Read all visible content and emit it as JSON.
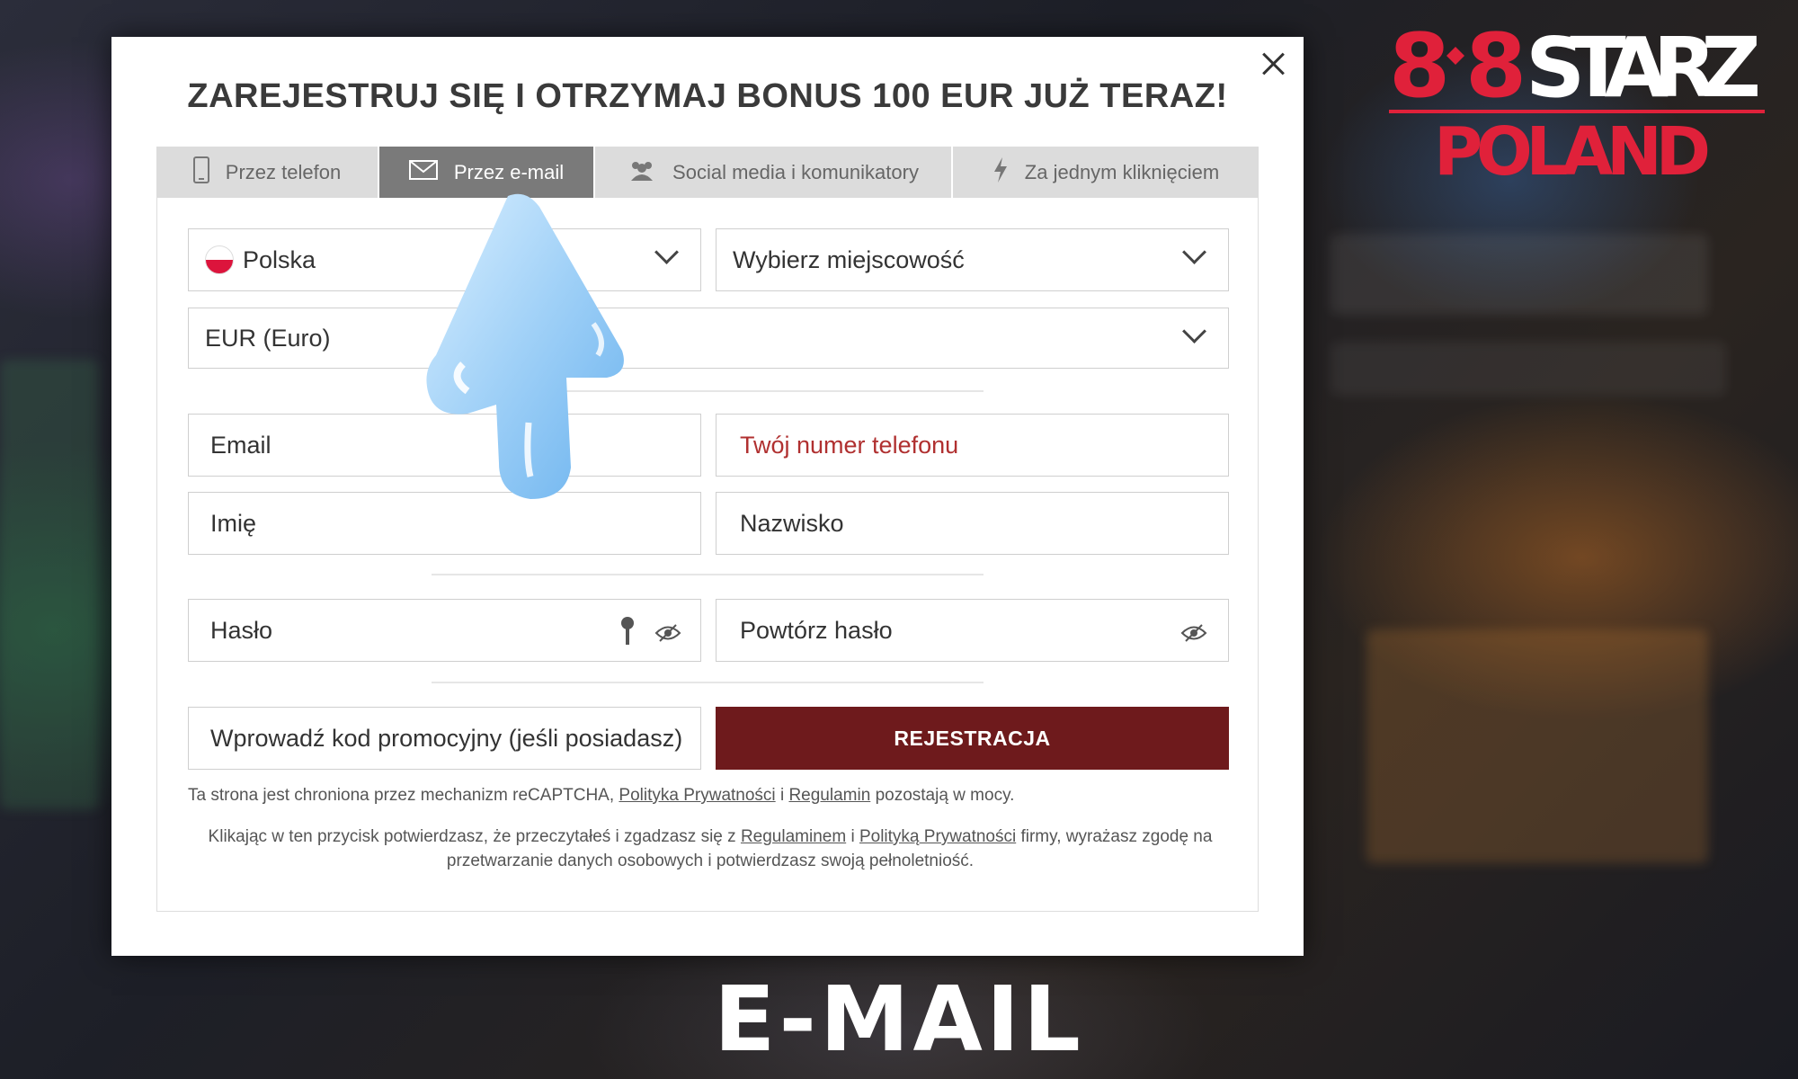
{
  "logo": {
    "brand_left": "8",
    "brand_right": "8",
    "brand_name": "STARZ",
    "region": "POLAND",
    "accent": "#e0213a"
  },
  "modal": {
    "title": "ZAREJESTRUJ SIĘ I OTRZYMAJ BONUS 100 EUR JUŻ TERAZ!",
    "tabs": [
      {
        "label": "Przez telefon",
        "icon": "phone-icon"
      },
      {
        "label": "Przez e-mail",
        "icon": "envelope-icon",
        "active": true
      },
      {
        "label": "Social media i komunikatory",
        "icon": "people-icon"
      },
      {
        "label": "Za jednym kliknięciem",
        "icon": "lightning-icon"
      }
    ],
    "country": "Polska",
    "city_placeholder": "Wybierz miejscowość",
    "currency": "EUR (Euro)",
    "email_placeholder": "Email",
    "phone_placeholder": "Twój numer telefonu",
    "first_name_placeholder": "Imię",
    "last_name_placeholder": "Nazwisko",
    "password_placeholder": "Hasło",
    "repeat_password_placeholder": "Powtórz hasło",
    "promo_placeholder": "Wprowadź kod promocyjny (jeśli posiadasz)",
    "register_label": "REJESTRACJA",
    "recaptcha": {
      "prefix": "Ta strona jest chroniona przez mechanizm reCAPTCHA,",
      "privacy": "Polityka Prywatności",
      "and": "i",
      "terms": "Regulamin",
      "suffix": "pozostają w mocy."
    },
    "consent": {
      "prefix": "Klikając w ten przycisk potwierdzasz, że przeczytałeś i zgadzasz się z",
      "terms": "Regulaminem",
      "and": "i",
      "privacy": "Polityką Prywatności",
      "suffix": "firmy, wyrażasz zgodę na",
      "line2": "przetwarzanie danych osobowych i potwierdzasz swoją pełnoletniość."
    },
    "button_color": "#6e1a1c",
    "phone_placeholder_color": "#b03030"
  },
  "footer": {
    "caption": "E-MAIL"
  }
}
